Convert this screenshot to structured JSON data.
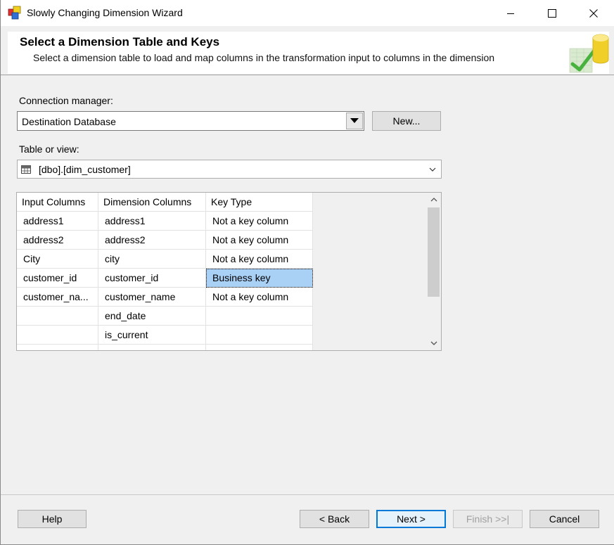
{
  "window": {
    "title": "Slowly Changing Dimension Wizard"
  },
  "header": {
    "title": "Select a Dimension Table and Keys",
    "subtitle": "Select a dimension table to load and map columns in the transformation input to columns in the dimension"
  },
  "connection": {
    "label": "Connection manager:",
    "value": "Destination Database",
    "new_button": "New..."
  },
  "table_view": {
    "label": "Table or view:",
    "value": "[dbo].[dim_customer]"
  },
  "grid": {
    "columns": [
      "Input Columns",
      "Dimension Columns",
      "Key Type"
    ],
    "rows": [
      [
        "address1",
        "address1",
        "Not a key column"
      ],
      [
        "address2",
        "address2",
        "Not a key column"
      ],
      [
        "City",
        "city",
        "Not a key column"
      ],
      [
        "customer_id",
        "customer_id",
        "Business key"
      ],
      [
        "customer_na...",
        "customer_name",
        "Not a key column"
      ],
      [
        "",
        "end_date",
        ""
      ],
      [
        "",
        "is_current",
        ""
      ]
    ],
    "selected_row": 3
  },
  "footer": {
    "help": "Help",
    "back": "< Back",
    "next": "Next >",
    "finish": "Finish >>|",
    "cancel": "Cancel"
  },
  "colors": {
    "selection": "#a9d0f5",
    "accent": "#0078d7",
    "background": "#f0f0f0"
  },
  "icons": [
    "app-icon",
    "minimize-icon",
    "maximize-icon",
    "close-icon",
    "dropdown-arrow-icon",
    "table-icon",
    "chevron-down-icon",
    "scroll-up-icon",
    "scroll-down-icon",
    "wizard-graphic"
  ]
}
